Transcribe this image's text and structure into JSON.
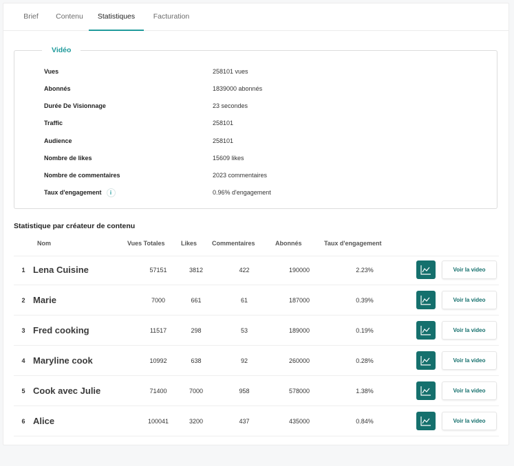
{
  "tabs": [
    {
      "label": "Brief",
      "active": false
    },
    {
      "label": "Contenu",
      "active": false
    },
    {
      "label": "Statistiques",
      "active": true
    },
    {
      "label": "Facturation",
      "active": false
    }
  ],
  "video": {
    "legend": "Vidéo",
    "rows": [
      {
        "label": "Vues",
        "value": "258101 vues"
      },
      {
        "label": "Abonnés",
        "value": "1839000 abonnés"
      },
      {
        "label": "Durée De Visionnage",
        "value": "23 secondes"
      },
      {
        "label": "Traffic",
        "value": "258101"
      },
      {
        "label": "Audience",
        "value": "258101"
      },
      {
        "label": "Nombre de likes",
        "value": "15609 likes"
      },
      {
        "label": "Nombre de commentaires",
        "value": "2023 commentaires"
      },
      {
        "label": "Taux d'engagement",
        "value": "0.96% d'engagement",
        "badge": "i"
      }
    ]
  },
  "creators": {
    "title": "Statistique par créateur de contenu",
    "headers": {
      "name": "Nom",
      "views": "Vues Totales",
      "likes": "Likes",
      "comments": "Commentaires",
      "subscribers": "Abonnés",
      "rate": "Taux d'engagement"
    },
    "button_label": "Voir la video",
    "rows": [
      {
        "rank": "1",
        "name": "Lena Cuisine",
        "views": "57151",
        "likes": "3812",
        "comments": "422",
        "subscribers": "190000",
        "rate": "2.23%"
      },
      {
        "rank": "2",
        "name": "Marie",
        "views": "7000",
        "likes": "661",
        "comments": "61",
        "subscribers": "187000",
        "rate": "0.39%"
      },
      {
        "rank": "3",
        "name": "Fred cooking",
        "views": "11517",
        "likes": "298",
        "comments": "53",
        "subscribers": "189000",
        "rate": "0.19%"
      },
      {
        "rank": "4",
        "name": "Maryline cook",
        "views": "10992",
        "likes": "638",
        "comments": "92",
        "subscribers": "260000",
        "rate": "0.28%"
      },
      {
        "rank": "5",
        "name": "Cook avec Julie",
        "views": "71400",
        "likes": "7000",
        "comments": "958",
        "subscribers": "578000",
        "rate": "1.38%"
      },
      {
        "rank": "6",
        "name": "Alice",
        "views": "100041",
        "likes": "3200",
        "comments": "437",
        "subscribers": "435000",
        "rate": "0.84%"
      }
    ]
  },
  "colors": {
    "accent": "#1e9a9b",
    "button_dark": "#15706d"
  },
  "icons": {
    "stats_button": "line-chart-icon",
    "info": "info-icon"
  }
}
